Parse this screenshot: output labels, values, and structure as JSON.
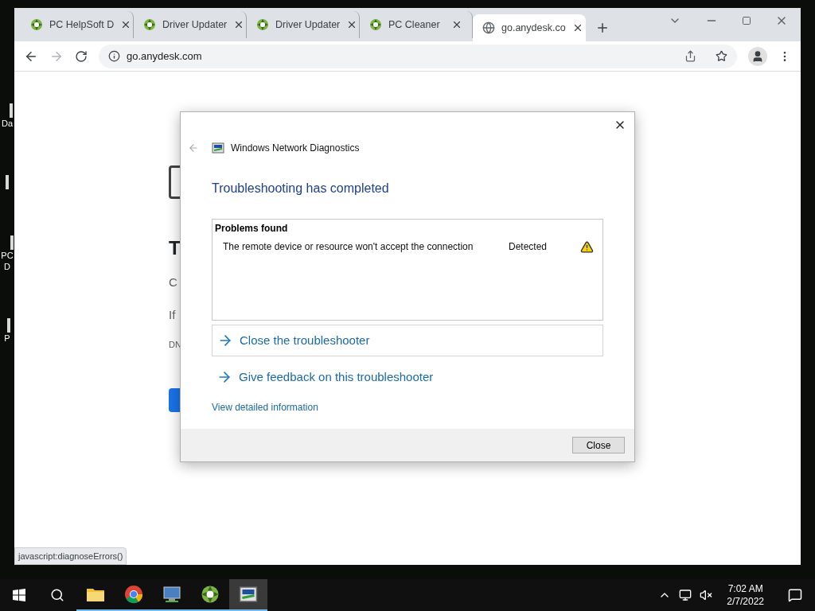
{
  "desktop": {
    "icons": [
      {
        "kind": "labeled",
        "lines": [
          "Da"
        ]
      },
      {
        "kind": "bare"
      },
      {
        "kind": "labeled",
        "lines": [
          "PC",
          "D"
        ]
      },
      {
        "kind": "labeled",
        "lines": [
          "P"
        ]
      }
    ]
  },
  "browser": {
    "tabs": [
      {
        "label": "PC HelpSoft D",
        "kind": "logo",
        "selected": false
      },
      {
        "label": "Driver Updater",
        "kind": "logo",
        "selected": false
      },
      {
        "label": "Driver Updater",
        "kind": "logo",
        "selected": false
      },
      {
        "label": "PC Cleaner",
        "kind": "logo",
        "selected": false
      },
      {
        "label": "go.anydesk.co",
        "kind": "globe",
        "selected": true
      }
    ],
    "address": "go.anydesk.com",
    "page": {
      "heading": "T",
      "lines": [
        "C",
        "If",
        "DN"
      ]
    },
    "status_link": "javascript:diagnoseErrors()"
  },
  "dialog": {
    "title": "Windows Network Diagnostics",
    "heading": "Troubleshooting has completed",
    "problems": {
      "header": "Problems found",
      "rows": [
        {
          "text": "The remote device or resource won't accept the connection",
          "status": "Detected"
        }
      ]
    },
    "links": [
      {
        "label": "Close the troubleshooter",
        "boxed": true
      },
      {
        "label": "Give feedback on this troubleshooter",
        "boxed": false
      }
    ],
    "detail_link": "View detailed information",
    "button": "Close"
  },
  "taskbar": {
    "apps": [
      {
        "kind": "folder",
        "selected": false
      },
      {
        "kind": "chrome",
        "selected": false
      },
      {
        "kind": "computer",
        "selected": false
      },
      {
        "kind": "logo",
        "selected": false
      },
      {
        "kind": "diagnostics",
        "selected": true
      }
    ],
    "time": "7:02 AM",
    "date": "2/7/2022"
  }
}
